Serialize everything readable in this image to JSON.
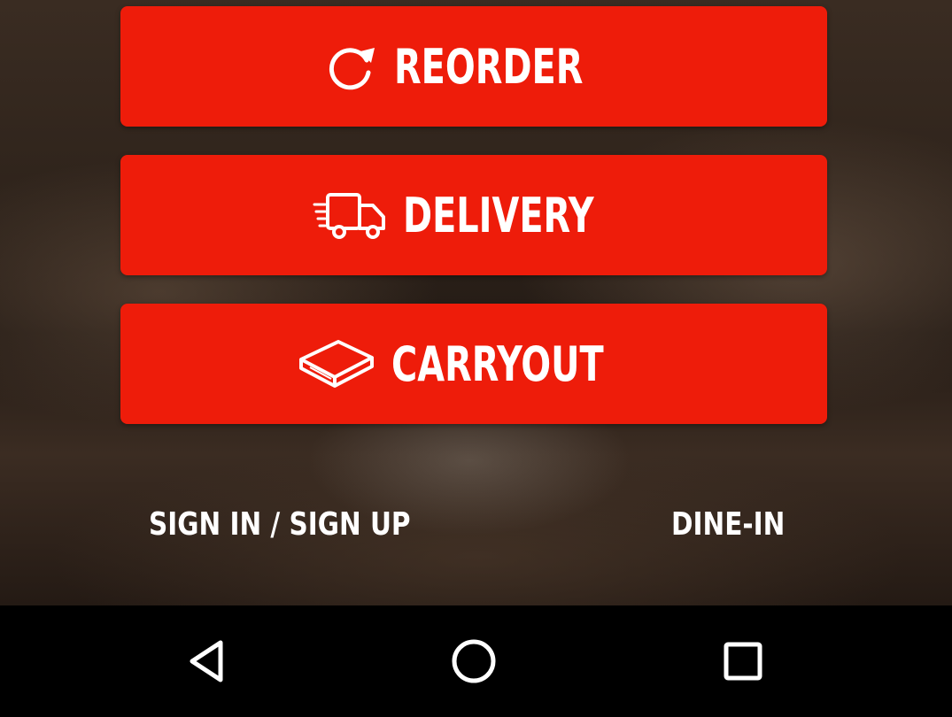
{
  "order_options": {
    "reorder": {
      "label": "REORDER",
      "icon": "refresh-icon"
    },
    "delivery": {
      "label": "DELIVERY",
      "icon": "delivery-truck-icon"
    },
    "carryout": {
      "label": "CARRYOUT",
      "icon": "pizza-box-icon"
    }
  },
  "links": {
    "sign_in": "SIGN IN / SIGN UP",
    "dine_in": "DINE-IN"
  },
  "system_nav": {
    "back_icon": "back-triangle-icon",
    "home_icon": "home-circle-icon",
    "recents_icon": "recents-square-icon"
  },
  "colors": {
    "button_red": "#ee1c0a",
    "text": "#ffffff",
    "navbar": "#000000"
  }
}
